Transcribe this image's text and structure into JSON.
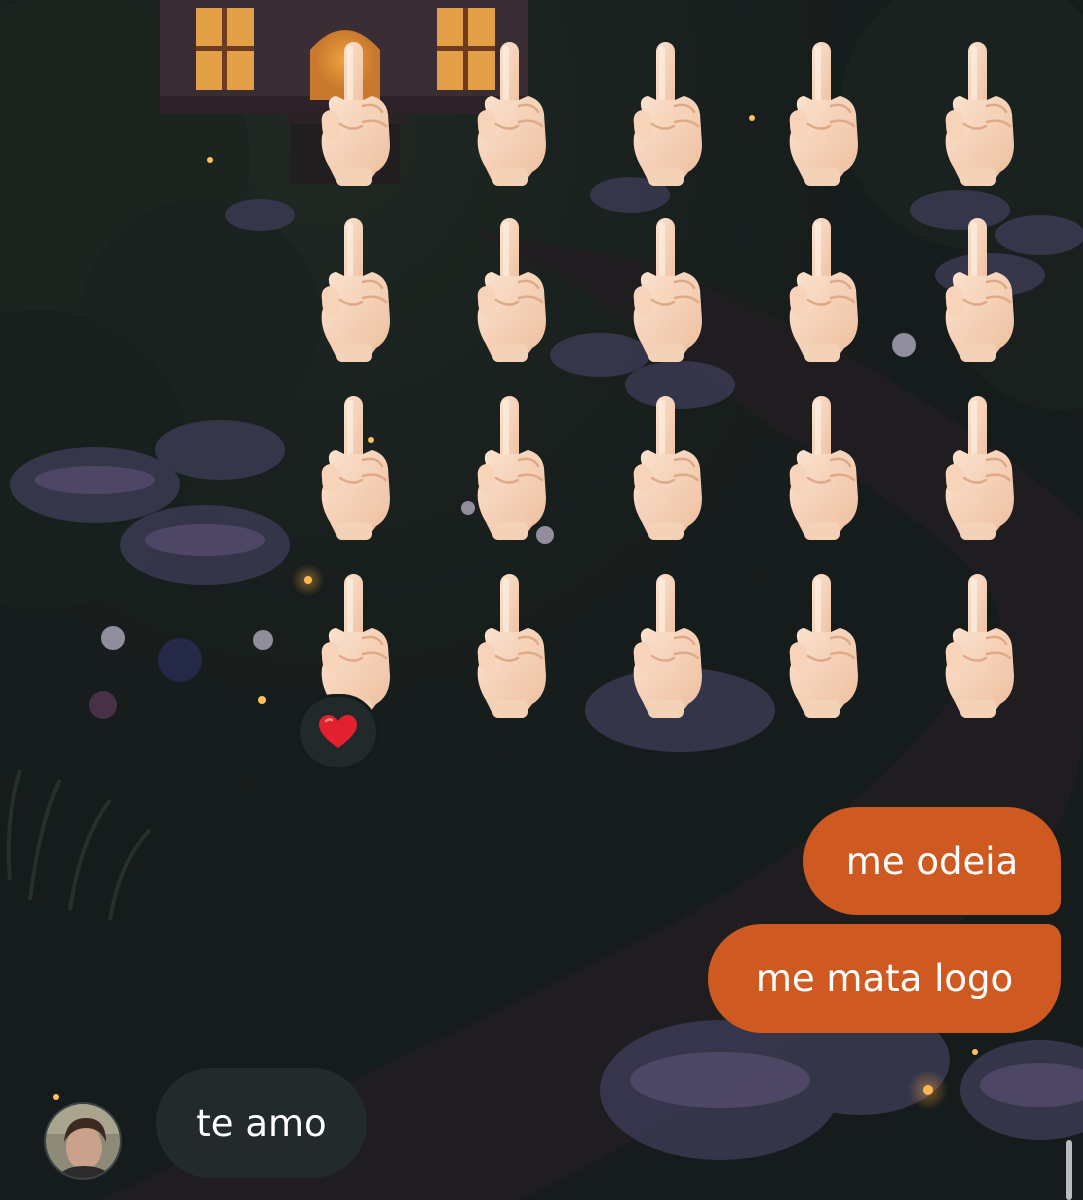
{
  "chat": {
    "emoji_grid": {
      "emoji": "middle-finger-emoji",
      "rows": 4,
      "cols": 5,
      "reaction": "red-heart-emoji"
    },
    "messages": [
      {
        "sender": "me",
        "text": "me odeia"
      },
      {
        "sender": "me",
        "text": "me mata logo"
      },
      {
        "sender": "other",
        "text": "te amo"
      }
    ]
  },
  "colors": {
    "sent_bubble": "#cf5a21",
    "received_bubble": "#222a2c",
    "background": "#15191a"
  }
}
